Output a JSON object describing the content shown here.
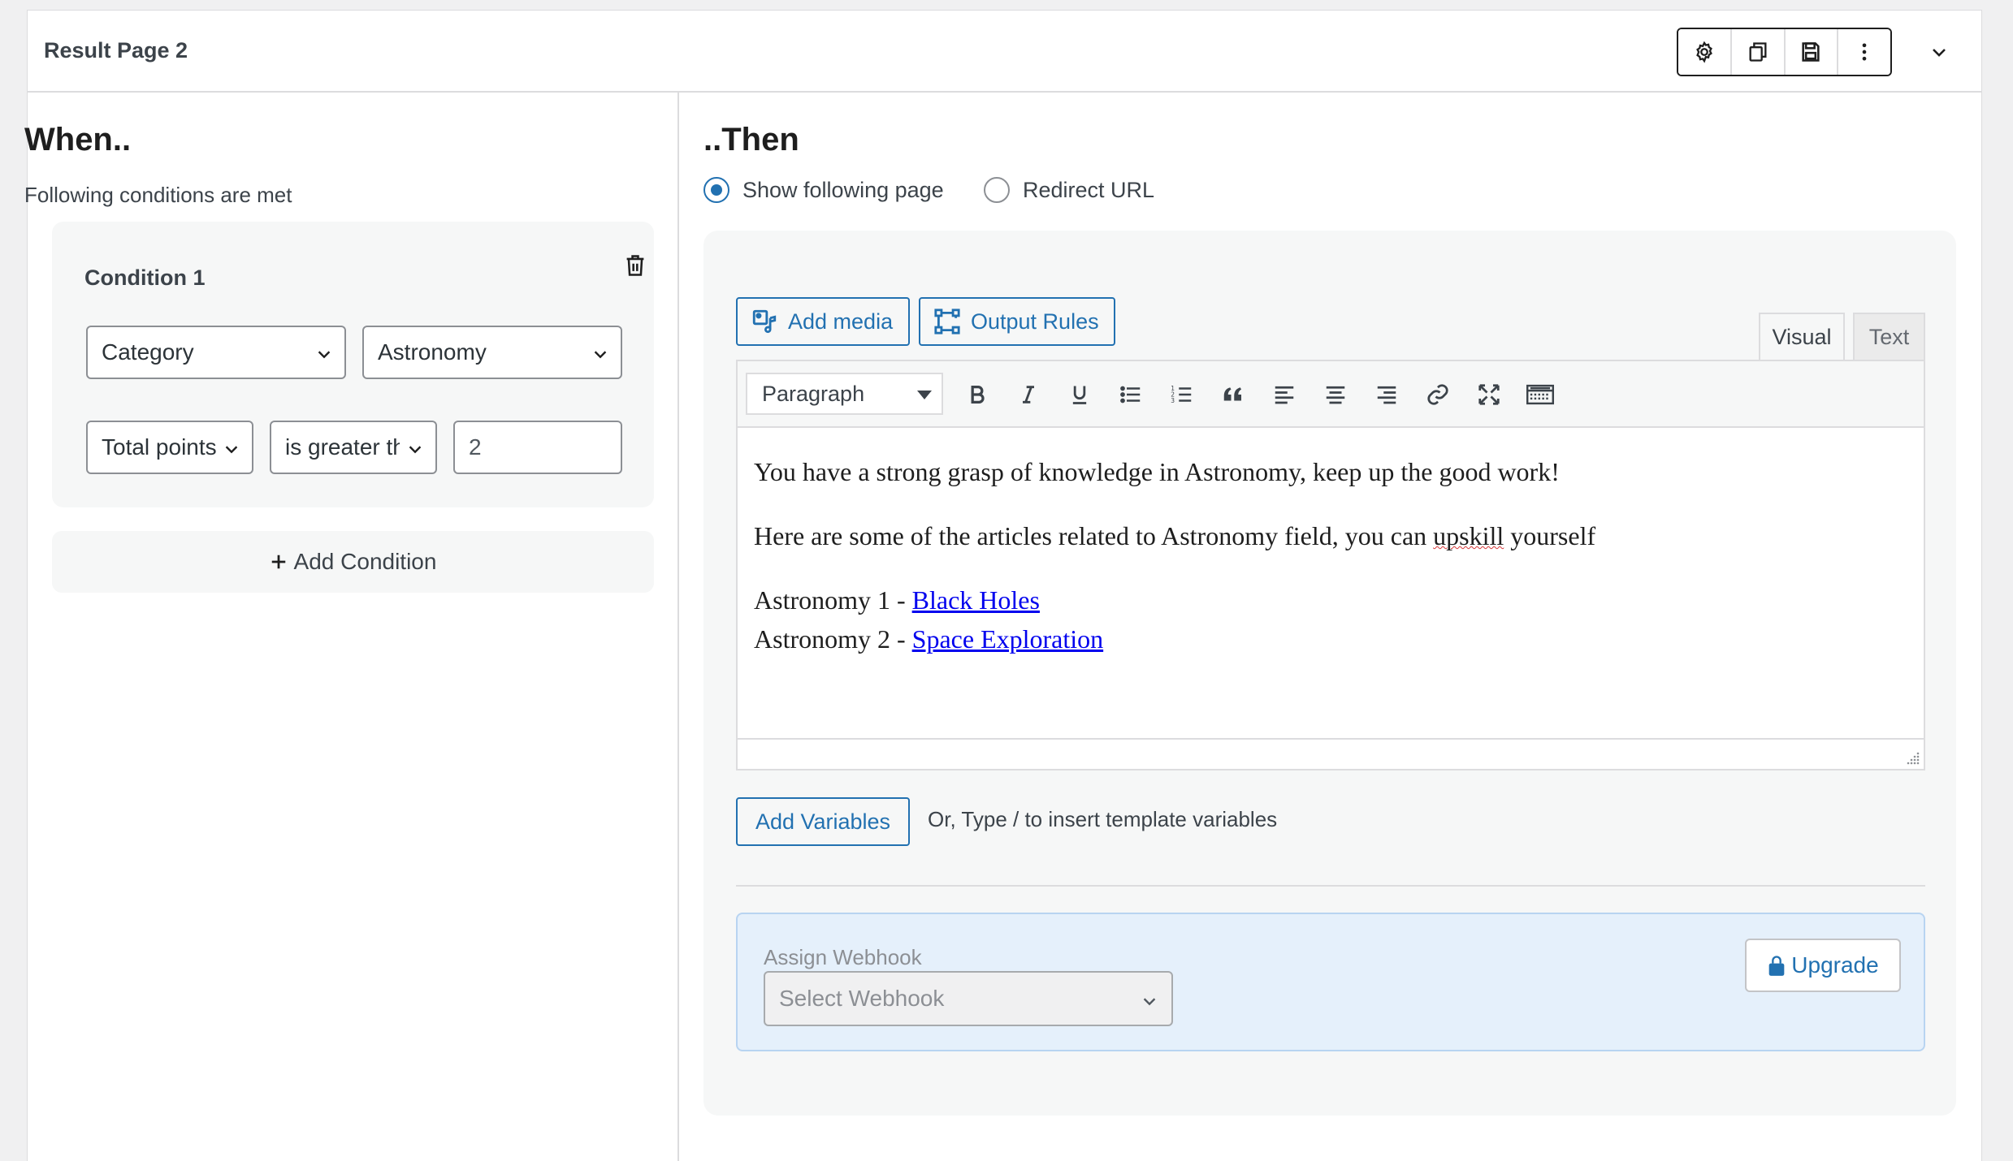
{
  "header": {
    "title": "Result Page 2",
    "toolbar": {
      "settings_icon": "gear-icon",
      "duplicate_icon": "duplicate-icon",
      "save_icon": "save-icon",
      "more_icon": "more-vertical-icon"
    },
    "collapse_icon": "chevron-down-icon"
  },
  "when": {
    "title": "When..",
    "subtitle": "Following conditions are met",
    "condition": {
      "label": "Condition 1",
      "field_select": "Category",
      "value_select": "Astronomy",
      "metric_select": "Total points",
      "operator_select": "is greater than",
      "amount_input": "2"
    },
    "add_condition_label": "Add Condition"
  },
  "then": {
    "title": "..Then",
    "radio_show": "Show following page",
    "radio_redirect": "Redirect URL",
    "selected": "show",
    "add_media_label": "Add media",
    "output_rules_label": "Output Rules",
    "tab_visual": "Visual",
    "tab_text": "Text",
    "format_select": "Paragraph",
    "content": {
      "line1": "You have a strong grasp of knowledge in Astronomy, keep up the good work!",
      "line2_pre": "Here are some of the articles related to Astronomy field, you can ",
      "line2_misspelled": "upskill",
      "line2_post": " yourself",
      "link1_prefix": "Astronomy 1 - ",
      "link1_text": "Black Holes",
      "link2_prefix": "Astronomy 2 - ",
      "link2_text": "Space Exploration"
    },
    "add_variables_label": "Add Variables",
    "variables_hint": "Or, Type / to insert template variables",
    "webhook": {
      "label": "Assign Webhook",
      "placeholder": "Select Webhook",
      "upgrade_label": "Upgrade"
    }
  },
  "colors": {
    "accent": "#2271b1",
    "link": "#0000ee",
    "webhook_bg": "#e5f0fb"
  }
}
